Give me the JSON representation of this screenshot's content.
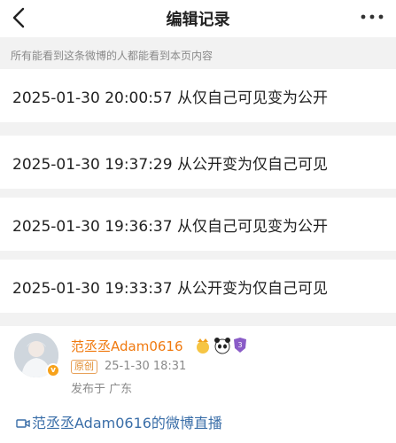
{
  "nav": {
    "title": "编辑记录"
  },
  "notice": "所有能看到这条微博的人都能看到本页内容",
  "records": [
    "2025-01-30 20:00:57 从仅自己可见变为公开",
    "2025-01-30 19:37:29 从公开变为仅自己可见",
    "2025-01-30 19:36:37 从仅自己可见变为公开",
    "2025-01-30 19:33:37 从公开变为仅自己可见"
  ],
  "post": {
    "username": "范丞丞Adam0616",
    "original_tag": "原创",
    "time": "25-1-30 18:31",
    "location": "发布于 广东",
    "live_link": "范丞丞Adam0616的微博直播",
    "emoji_icons": [
      "crown-emoji-icon",
      "panda-emoji-icon",
      "shield-badge-icon"
    ],
    "verified_badge": "v-badge-icon"
  },
  "colors": {
    "accent": "#f07a10",
    "link": "#3a6ea8",
    "separator": "#f2f2f2"
  }
}
